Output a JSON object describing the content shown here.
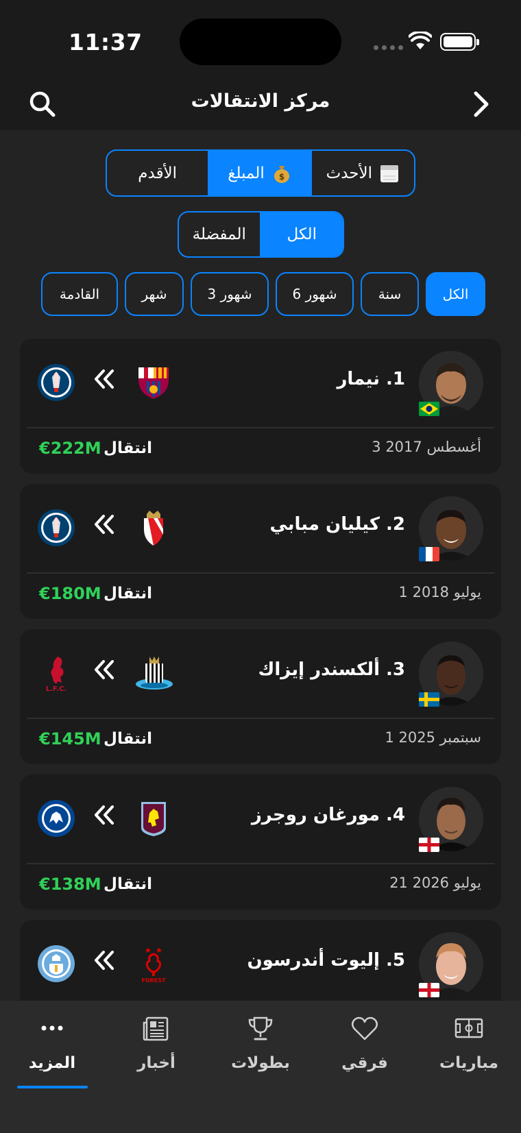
{
  "status_bar": {
    "time": "11:37"
  },
  "header": {
    "title": "مركز الانتقالات"
  },
  "sort_tabs": [
    {
      "label": "الأحدث",
      "icon": "calendar-icon",
      "active": false
    },
    {
      "label": "المبلغ",
      "icon": "money-bag-icon",
      "active": true
    },
    {
      "label": "الأقدم",
      "icon": "",
      "active": false
    }
  ],
  "scope_tabs": [
    {
      "label": "الكل",
      "active": true
    },
    {
      "label": "المفضلة",
      "active": false
    }
  ],
  "period_filters": [
    {
      "label": "الكل",
      "active": true
    },
    {
      "label": "سنة",
      "active": false
    },
    {
      "label": "6 شهور",
      "active": false
    },
    {
      "label": "3 شهور",
      "active": false
    },
    {
      "label": "شهر",
      "active": false
    },
    {
      "label": "القادمة",
      "active": false
    }
  ],
  "transfers": [
    {
      "rank_name": "1. نيمار",
      "date": "3 أغسطس 2017",
      "type": "انتقال",
      "fee": "€222M",
      "flag": "brazil",
      "from_club": "fc-barcelona-crest",
      "to_club": "psg-crest",
      "colors": {
        "skin": "#b07a55",
        "hair": "#2a2018"
      }
    },
    {
      "rank_name": "2. كيليان مبابي",
      "date": "1 يوليو 2018",
      "type": "انتقال",
      "fee": "€180M",
      "flag": "france",
      "from_club": "as-monaco-crest",
      "to_club": "psg-crest",
      "colors": {
        "skin": "#6b4329",
        "hair": "#1a1210"
      }
    },
    {
      "rank_name": "3. ألكسندر إيزاك",
      "date": "1 سبتمبر 2025",
      "type": "انتقال",
      "fee": "€145M",
      "flag": "sweden",
      "from_club": "newcastle-crest",
      "to_club": "liverpool-crest",
      "colors": {
        "skin": "#4a2c1e",
        "hair": "#151010"
      }
    },
    {
      "rank_name": "4. مورغان روجرز",
      "date": "21 يوليو 2026",
      "type": "انتقال",
      "fee": "€138M",
      "flag": "england",
      "from_club": "aston-villa-crest",
      "to_club": "chelsea-crest",
      "colors": {
        "skin": "#9b6a4a",
        "hair": "#1e1612"
      }
    },
    {
      "rank_name": "5. إليوت أندرسون",
      "date": "",
      "type": "",
      "fee": "",
      "flag": "england",
      "from_club": "nottingham-forest-crest",
      "to_club": "manchester-city-crest",
      "colors": {
        "skin": "#e5b49a",
        "hair": "#c88a5a"
      }
    }
  ],
  "tab_bar": [
    {
      "label": "مباريات",
      "icon": "pitch-icon",
      "active": false
    },
    {
      "label": "فرقي",
      "icon": "heart-icon",
      "active": false
    },
    {
      "label": "بطولات",
      "icon": "trophy-icon",
      "active": false
    },
    {
      "label": "أخبار",
      "icon": "newspaper-icon",
      "active": false
    },
    {
      "label": "المزيد",
      "icon": "more-icon",
      "active": true
    }
  ],
  "theme": {
    "accent": "#0a84ff",
    "fee_green": "#30d158",
    "background": "#232323",
    "card": "#1b1b1b"
  }
}
